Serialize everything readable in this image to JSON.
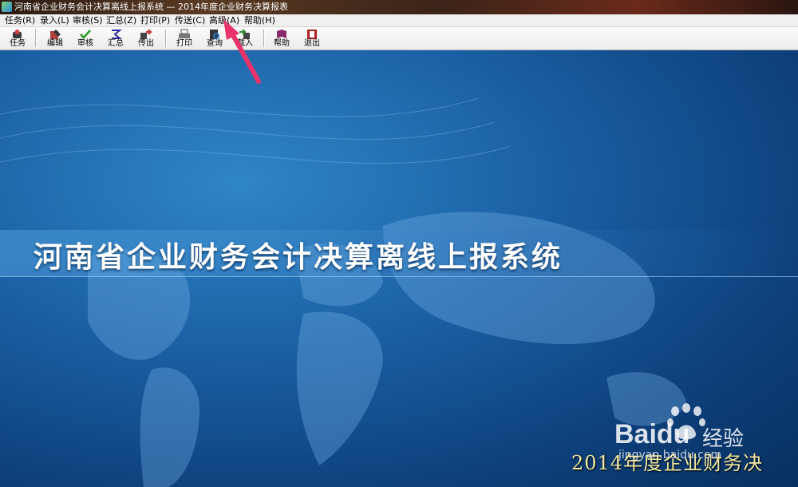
{
  "window": {
    "title": "河南省企业财务会计决算离线上报系统 — 2014年度企业财务决算报表"
  },
  "menu": [
    {
      "label": "任务(R)"
    },
    {
      "label": "录入(L)"
    },
    {
      "label": "审核(S)"
    },
    {
      "label": "汇总(Z)"
    },
    {
      "label": "打印(P)"
    },
    {
      "label": "传送(C)"
    },
    {
      "label": "高级(A)"
    },
    {
      "label": "帮助(H)"
    }
  ],
  "toolbar": [
    {
      "label": "任务",
      "icon": "task-icon"
    },
    {
      "label": "编辑",
      "icon": "edit-icon"
    },
    {
      "label": "审核",
      "icon": "audit-icon"
    },
    {
      "label": "汇总",
      "icon": "summary-icon"
    },
    {
      "label": "传出",
      "icon": "export-icon"
    },
    {
      "label": "打印",
      "icon": "print-icon"
    },
    {
      "label": "查询",
      "icon": "query-icon"
    },
    {
      "label": "载入",
      "icon": "import-icon"
    },
    {
      "label": "帮助",
      "icon": "help-icon"
    },
    {
      "label": "退出",
      "icon": "exit-icon"
    }
  ],
  "main": {
    "system_title": "河南省企业财务会计决算离线上报系统",
    "year_title": "2014年度企业财务决"
  },
  "watermark": {
    "brand": "Baidu",
    "cn": "经验",
    "url": "jingyan.baidu.com"
  },
  "colors": {
    "background": "#1a5fa3",
    "annotation_arrow": "#e8336b",
    "year_title": "#f2e8a0"
  }
}
